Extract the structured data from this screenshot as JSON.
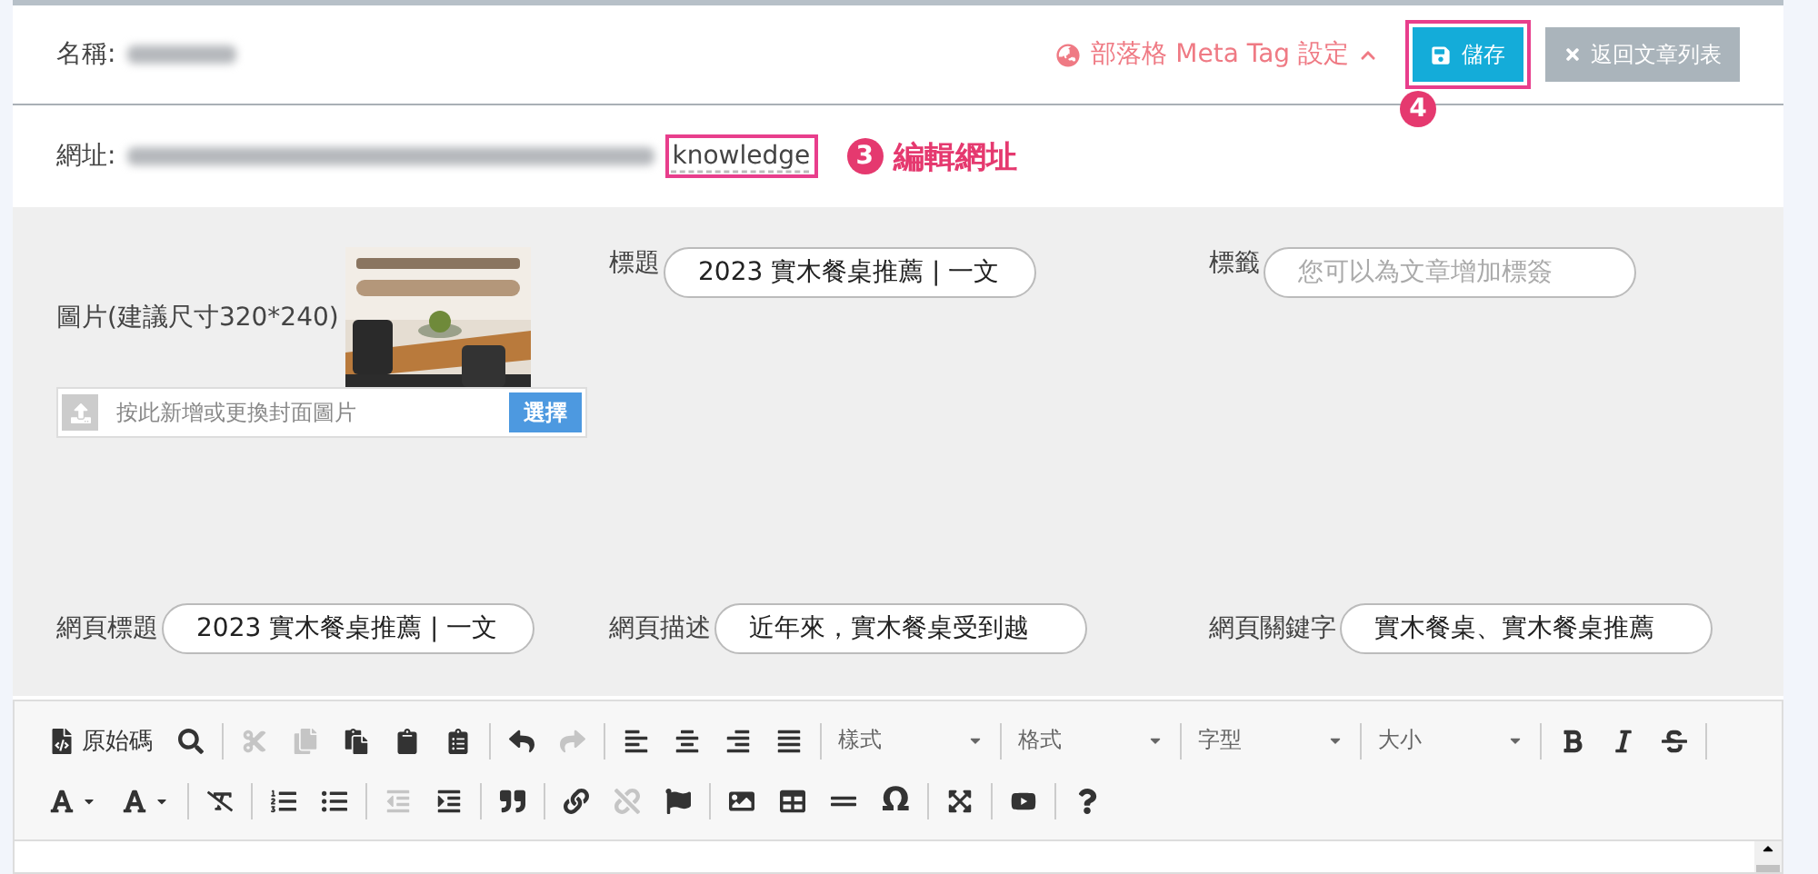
{
  "header": {
    "name_label": "名稱:",
    "meta_link": {
      "label": "部落格 Meta Tag 設定",
      "expanded": true
    },
    "save_button": "儲存",
    "back_button": "返回文章列表",
    "save_marker": "4"
  },
  "url_row": {
    "label": "網址:",
    "slug": "knowledge",
    "marker": "3",
    "hint": "編輯網址"
  },
  "form": {
    "image": {
      "label": "圖片(建議尺寸320*240)",
      "upload_placeholder": "按此新增或更換封面圖片",
      "choose_button": "選擇"
    },
    "fields": [
      {
        "label": "標題",
        "value": "2023 實木餐桌推薦 | 一文"
      },
      {
        "label": "標籤",
        "placeholder": "您可以為文章增加標簽"
      },
      {
        "label": "網頁標題",
        "value": "2023 實木餐桌推薦 | 一文"
      },
      {
        "label": "網頁描述",
        "value": "近年來，實木餐桌受到越"
      },
      {
        "label": "網頁關鍵字",
        "value": "實木餐桌、實木餐桌推薦"
      }
    ]
  },
  "toolbar": {
    "rows": [
      [
        {
          "kind": "button",
          "label": "原始碼",
          "disabled": false
        },
        {
          "kind": "button",
          "disabled": false
        },
        {
          "kind": "separator"
        },
        {
          "kind": "button",
          "disabled": true
        },
        {
          "kind": "button",
          "disabled": true
        },
        {
          "kind": "button",
          "disabled": false
        },
        {
          "kind": "button",
          "disabled": false
        },
        {
          "kind": "button",
          "disabled": false
        },
        {
          "kind": "separator"
        },
        {
          "kind": "button",
          "disabled": false
        },
        {
          "kind": "button",
          "disabled": true
        },
        {
          "kind": "separator"
        },
        {
          "kind": "button",
          "disabled": false
        },
        {
          "kind": "button",
          "disabled": false
        },
        {
          "kind": "button",
          "disabled": false
        },
        {
          "kind": "button",
          "disabled": false
        },
        {
          "kind": "separator"
        },
        {
          "kind": "dropdown",
          "label": "樣式"
        },
        {
          "kind": "separator"
        },
        {
          "kind": "dropdown",
          "label": "格式"
        },
        {
          "kind": "separator"
        },
        {
          "kind": "dropdown",
          "label": "字型"
        },
        {
          "kind": "separator"
        },
        {
          "kind": "dropdown",
          "label": "大小"
        },
        {
          "kind": "separator"
        },
        {
          "kind": "button",
          "disabled": false
        },
        {
          "kind": "button",
          "disabled": false
        },
        {
          "kind": "button",
          "disabled": false
        },
        {
          "kind": "separator"
        }
      ],
      [
        {
          "kind": "button",
          "disabled": false
        },
        {
          "kind": "button",
          "disabled": false
        },
        {
          "kind": "separator"
        },
        {
          "kind": "button",
          "disabled": false
        },
        {
          "kind": "separator"
        },
        {
          "kind": "button",
          "disabled": false
        },
        {
          "kind": "button",
          "disabled": false
        },
        {
          "kind": "separator"
        },
        {
          "kind": "button",
          "disabled": true
        },
        {
          "kind": "button",
          "disabled": false
        },
        {
          "kind": "separator"
        },
        {
          "kind": "button",
          "disabled": false
        },
        {
          "kind": "separator"
        },
        {
          "kind": "button",
          "disabled": false
        },
        {
          "kind": "button",
          "disabled": true
        },
        {
          "kind": "button",
          "disabled": false
        },
        {
          "kind": "separator"
        },
        {
          "kind": "button",
          "disabled": false
        },
        {
          "kind": "button",
          "disabled": false
        },
        {
          "kind": "button",
          "disabled": false
        },
        {
          "kind": "button",
          "label": "Ω",
          "disabled": false
        },
        {
          "kind": "separator"
        },
        {
          "kind": "button",
          "disabled": false
        },
        {
          "kind": "separator"
        },
        {
          "kind": "button",
          "disabled": false
        },
        {
          "kind": "separator"
        },
        {
          "kind": "button",
          "disabled": false
        }
      ]
    ]
  }
}
